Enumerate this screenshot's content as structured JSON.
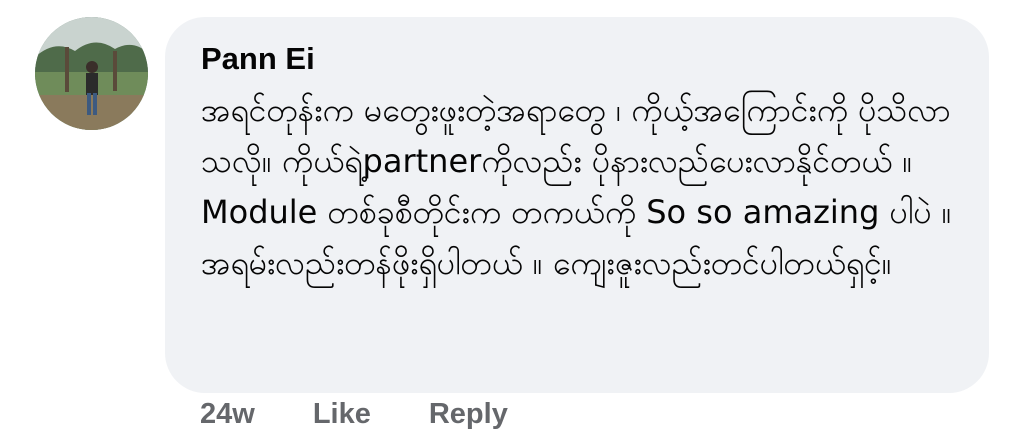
{
  "comment": {
    "author": "Pann Ei",
    "text": "အရင်တုန်းက မတွေးဖူးတဲ့အရာတွေ ၊ ကိုယ့်အကြောင်းကို ပိုသိလာသလို။ ကိုယ်ရဲ့partnerကိုလည်း ပိုနားလည်ပေးလာနိုင်တယ် ။ Module တစ်ခုစီတိုင်းက တကယ်ကို So so amazing ပါပဲ ။ အရမ်းလည်းတန်ဖိုးရှိပါတယ် ။ ကျေးဇူးလည်းတင်ပါတယ်ရှင့်။",
    "avatar_icon": "profile-photo",
    "bubble_color": "#f0f2f5"
  },
  "actions": {
    "time": "24w",
    "like": "Like",
    "reply": "Reply",
    "color": "#65676b"
  }
}
